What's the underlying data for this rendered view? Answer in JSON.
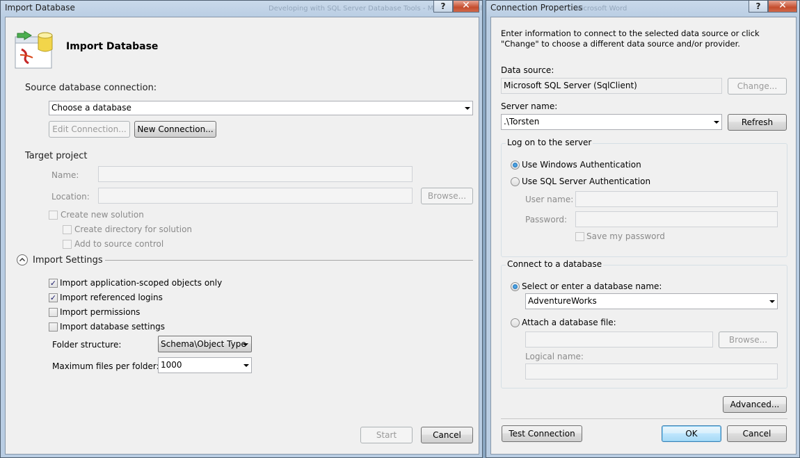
{
  "import_dialog": {
    "title": "Import Database",
    "background_title": "Developing with SQL Server Database Tools - Microsoft Visual",
    "help_glyph": "?",
    "close_glyph": "✕",
    "heading": "Import Database",
    "source_connection_label": "Source database connection:",
    "database_combo_value": "Choose a database",
    "edit_connection_label": "Edit Connection...",
    "new_connection_label": "New Connection...",
    "target_project_label": "Target project",
    "name_label": "Name:",
    "location_label": "Location:",
    "browse_label": "Browse...",
    "create_new_solution_label": "Create new solution",
    "create_directory_label": "Create directory for solution",
    "add_source_control_label": "Add to source control",
    "import_settings_label": "Import Settings",
    "options": [
      {
        "label": "Import application-scoped objects only",
        "checked": true
      },
      {
        "label": "Import referenced logins",
        "checked": true
      },
      {
        "label": "Import permissions",
        "checked": false
      },
      {
        "label": "Import database settings",
        "checked": false
      }
    ],
    "folder_structure_label": "Folder structure:",
    "folder_structure_value": "Schema\\Object Type",
    "max_files_label": "Maximum files per folder:",
    "max_files_value": "1000",
    "start_label": "Start",
    "cancel_label": "Cancel"
  },
  "connection_dialog": {
    "title": "Connection Properties",
    "background_title": "Microsoft Word",
    "help_glyph": "?",
    "close_glyph": "✕",
    "intro_text": "Enter information to connect to the selected data source or click \"Change\" to choose a different data source and/or provider.",
    "data_source_label": "Data source:",
    "data_source_value": "Microsoft SQL Server (SqlClient)",
    "change_label": "Change...",
    "server_name_label": "Server name:",
    "server_name_value": ".\\Torsten",
    "refresh_label": "Refresh",
    "logon_group_label": "Log on to the server",
    "windows_auth_label": "Use Windows Authentication",
    "sql_auth_label": "Use SQL Server Authentication",
    "user_name_label": "User name:",
    "password_label": "Password:",
    "save_password_label": "Save my password",
    "connect_group_label": "Connect to a database",
    "select_db_label": "Select or enter a database name:",
    "db_name_value": "AdventureWorks",
    "attach_label": "Attach a database file:",
    "browse_label": "Browse...",
    "logical_name_label": "Logical name:",
    "advanced_label": "Advanced...",
    "test_connection_label": "Test Connection",
    "ok_label": "OK",
    "cancel_label": "Cancel"
  },
  "colors": {
    "desktop": "#8aa6c2",
    "window_frame": "#c9d9ea",
    "client": "#f0f0f0",
    "close_button": "#c44d2d",
    "default_button": "#3c7fb1"
  }
}
